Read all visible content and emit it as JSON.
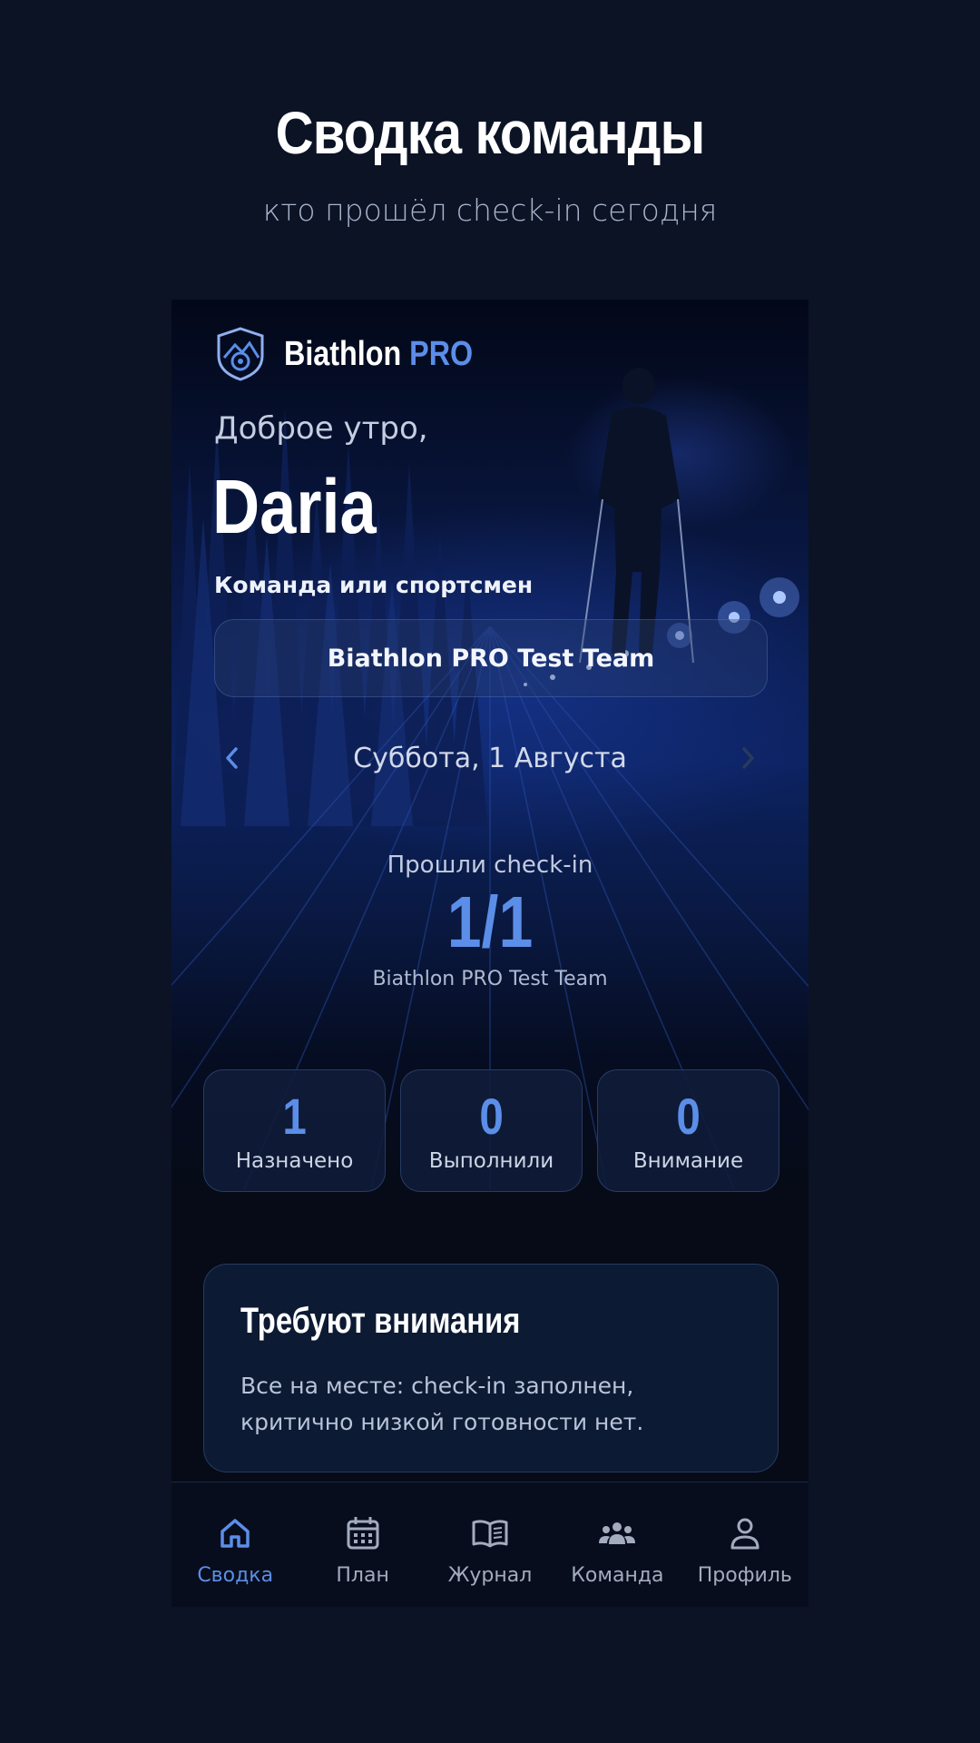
{
  "header": {
    "title": "Сводка команды",
    "subtitle": "кто прошёл check-in сегодня"
  },
  "app": {
    "brand_name": "Biathlon",
    "brand_accent": "PRO",
    "greeting": "Доброе утро,",
    "username": "Daria",
    "team_label": "Команда или спортсмен",
    "team_selected": "Biathlon PRO Test Team",
    "date": "Суббота, 1 Августа",
    "checkin": {
      "label": "Прошли check-in",
      "value": "1/1",
      "team": "Biathlon PRO Test Team"
    },
    "stats": [
      {
        "value": "1",
        "label": "Назначено"
      },
      {
        "value": "0",
        "label": "Выполнили"
      },
      {
        "value": "0",
        "label": "Внимание"
      }
    ],
    "attention": {
      "title": "Требуют внимания",
      "text": "Все на месте: check-in заполнен, критично низкой готовности нет."
    },
    "nav": [
      {
        "label": "Сводка",
        "icon": "home-icon",
        "active": true
      },
      {
        "label": "План",
        "icon": "calendar-icon",
        "active": false
      },
      {
        "label": "Журнал",
        "icon": "book-icon",
        "active": false
      },
      {
        "label": "Команда",
        "icon": "team-icon",
        "active": false
      },
      {
        "label": "Профиль",
        "icon": "profile-icon",
        "active": false
      }
    ]
  },
  "colors": {
    "background": "#0b1325",
    "accent": "#5b8ee8",
    "card": "#0c1a33"
  }
}
